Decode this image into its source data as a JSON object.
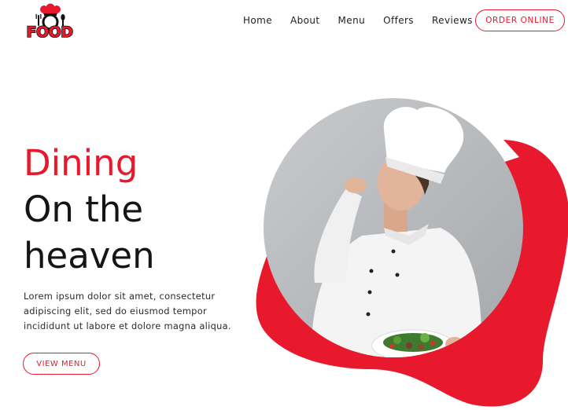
{
  "brand": {
    "logo_text": "FOOD",
    "logo_icon": "chef-hat-with-fork-and-spoon-logo",
    "accent_color": "#e8192c"
  },
  "nav": {
    "items": [
      {
        "label": "Home"
      },
      {
        "label": "About"
      },
      {
        "label": "Menu"
      },
      {
        "label": "Offers"
      },
      {
        "label": "Reviews"
      }
    ],
    "cta_label": "ORDER ONLINE"
  },
  "hero": {
    "title_line1": "Dining",
    "title_line2": "On the",
    "title_line3": "heaven",
    "description": "Lorem ipsum dolor sit amet, consectetur adipiscing elit, sed do eiusmod tempor incididunt ut labore et dolore magna aliqua.",
    "button_label": "VIEW MENU",
    "image": "chef-kissing-fingers-holding-salad-plate"
  }
}
